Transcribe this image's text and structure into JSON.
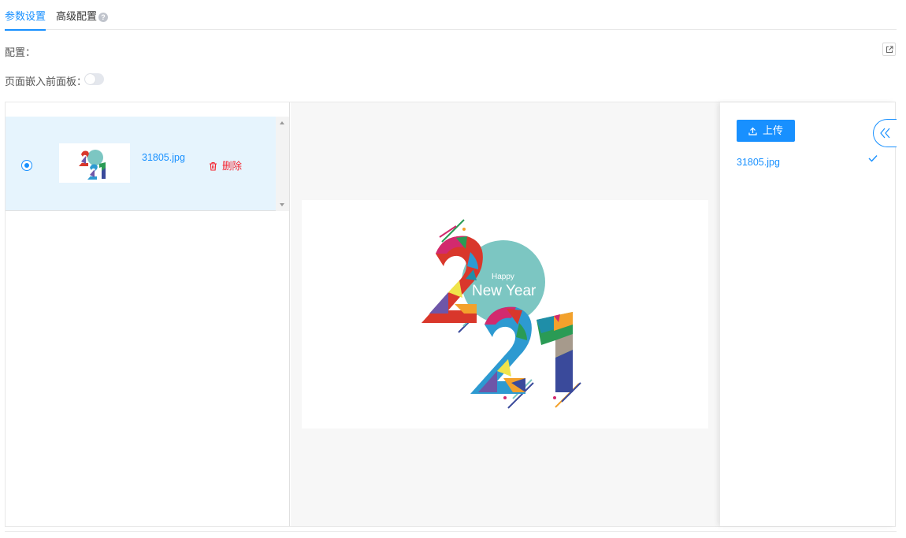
{
  "tabs": [
    {
      "label": "参数设置",
      "active": true
    },
    {
      "label": "高级配置",
      "active": false
    }
  ],
  "help_icon_glyph": "?",
  "config": {
    "label": "配置："
  },
  "embed": {
    "label": "页面嵌入前面板：",
    "enabled": false
  },
  "file_list": {
    "items": [
      {
        "name": "31805.jpg",
        "selected": true,
        "delete_label": "删除"
      }
    ]
  },
  "preview": {
    "image_name": "31805.jpg",
    "image_text": {
      "happy": "Happy",
      "new_year": "New Year"
    }
  },
  "upload": {
    "button_label": "上传",
    "files": [
      {
        "name": "31805.jpg",
        "status": "uploaded"
      }
    ]
  },
  "colors": {
    "accent": "#1890ff",
    "danger": "#f5222d",
    "selected_row": "#e6f4fd",
    "circle": "#7cc6c2"
  },
  "icons": {
    "help": "help-icon",
    "expand": "external-link-icon",
    "delete": "trash-icon",
    "upload": "upload-icon",
    "check": "check-icon",
    "collapse": "double-chevron-left-icon"
  }
}
